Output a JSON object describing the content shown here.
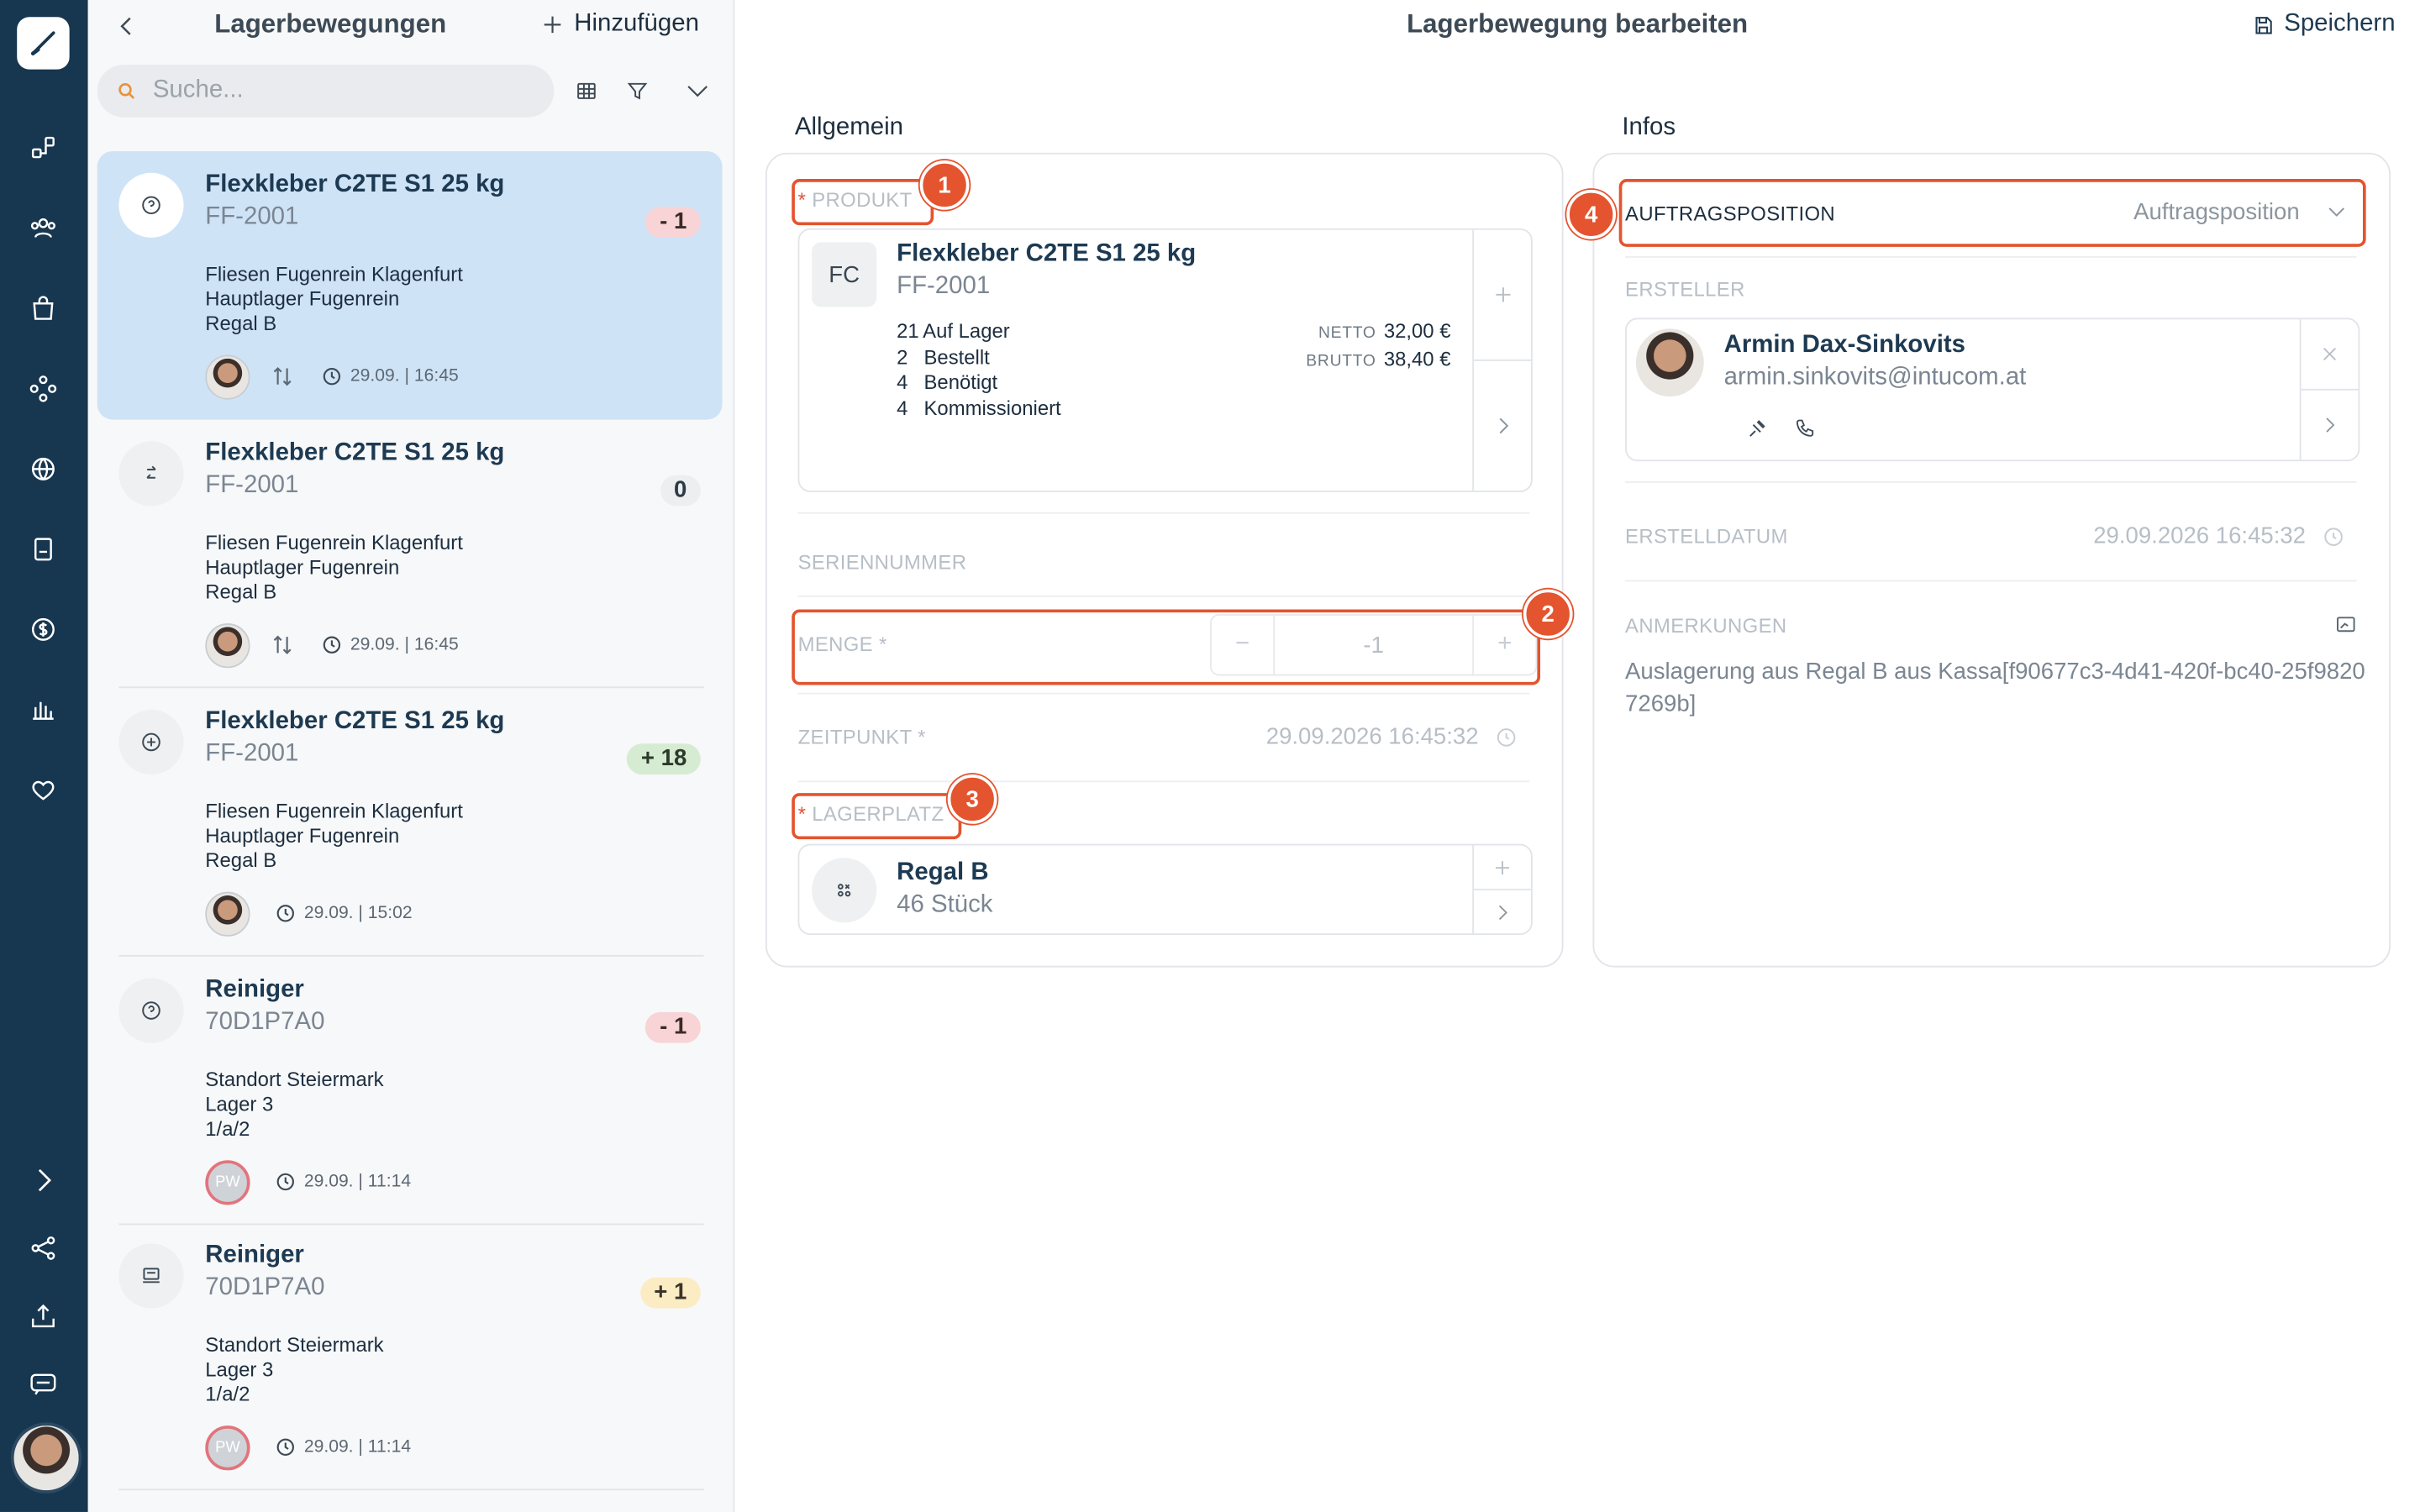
{
  "nav": {
    "items": [
      "brush-logo",
      "workflow",
      "team",
      "shop",
      "components",
      "globe",
      "book",
      "money",
      "chart",
      "heart",
      "expand",
      "share",
      "upload",
      "messages"
    ]
  },
  "list": {
    "title": "Lagerbewegungen",
    "add_label": "Hinzufügen",
    "search_placeholder": "Suche...",
    "items": [
      {
        "name": "Flexkleber C2TE S1 25 kg",
        "code": "FF-2001",
        "badge": "- 1",
        "line1": "Fliesen Fugenrein Klagenfurt",
        "line2": "Hauptlager Fugenrein",
        "line3": "Regal B",
        "time": "29.09. | 16:45"
      },
      {
        "name": "Flexkleber C2TE S1 25 kg",
        "code": "FF-2001",
        "badge": "0",
        "line1": "Fliesen Fugenrein Klagenfurt",
        "line2": "Hauptlager Fugenrein",
        "line3": "Regal B",
        "time": "29.09. | 16:45"
      },
      {
        "name": "Flexkleber C2TE S1 25 kg",
        "code": "FF-2001",
        "badge": "+ 18",
        "line1": "Fliesen Fugenrein Klagenfurt",
        "line2": "Hauptlager Fugenrein",
        "line3": "Regal B",
        "time": "29.09. | 15:02"
      },
      {
        "name": "Reiniger",
        "code": "70D1P7A0",
        "badge": "- 1",
        "line1": "Standort Steiermark",
        "line2": "Lager 3",
        "line3": "1/a/2",
        "time": "29.09. | 11:14",
        "avatar": "PW"
      },
      {
        "name": "Reiniger",
        "code": "70D1P7A0",
        "badge": "+ 1",
        "line1": "Standort Steiermark",
        "line2": "Lager 3",
        "line3": "1/a/2",
        "time": "29.09. | 11:14",
        "avatar": "PW"
      }
    ]
  },
  "detail": {
    "title": "Lagerbewegung bearbeiten",
    "save_label": "Speichern",
    "general": {
      "heading": "Allgemein",
      "product_label": "PRODUKT",
      "product": {
        "initials": "FC",
        "name": "Flexkleber C2TE S1 25 kg",
        "code": "FF-2001",
        "stock": [
          {
            "count": "21",
            "label": "Auf Lager"
          },
          {
            "count": "2",
            "label": "Bestellt"
          },
          {
            "count": "4",
            "label": "Benötigt"
          },
          {
            "count": "4",
            "label": "Kommissioniert"
          }
        ],
        "net_label": "NETTO",
        "net": "32,00 €",
        "gross_label": "BRUTTO",
        "gross": "38,40 €"
      },
      "serial_label": "SERIENNUMMER",
      "quantity_label": "MENGE *",
      "quantity_value": "-1",
      "time_label": "ZEITPUNKT *",
      "time_value": "29.09.2026 16:45:32",
      "location_label": "LAGERPLATZ",
      "location": {
        "name": "Regal B",
        "sub": "46 Stück"
      }
    },
    "info": {
      "heading": "Infos",
      "order_label": "AUFTRAGSPOSITION",
      "order_placeholder": "Auftragsposition",
      "creator_label": "ERSTELLER",
      "creator": {
        "name": "Armin Dax-Sinkovits",
        "email": "armin.sinkovits@intucom.at"
      },
      "created_label": "ERSTELLDATUM",
      "created_value": "29.09.2026 16:45:32",
      "notes_label": "ANMERKUNGEN",
      "notes": "Auslagerung aus Regal B aus Kassa[f90677c3-4d41-420f-bc40-25f98207269b]"
    },
    "annotations": [
      "1",
      "2",
      "3",
      "4"
    ]
  },
  "colors": {
    "rail": "#17364f",
    "highlight": "#e4542f",
    "selected": "#cfe3f7"
  }
}
